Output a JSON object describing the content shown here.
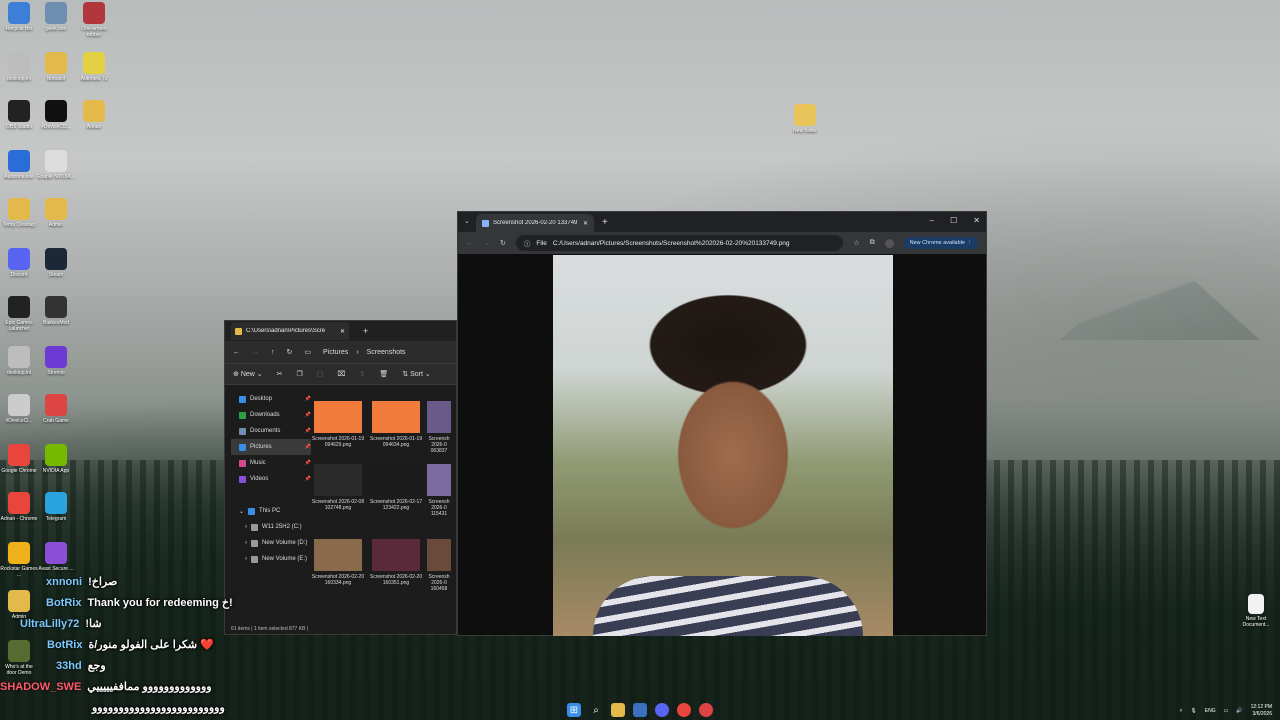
{
  "desktop": {
    "icons_left": [
      {
        "label": "Recycle Bin",
        "icon": "recycle-bin-icon",
        "color": "#3d7fd6"
      },
      {
        "label": "geek.exe",
        "icon": "geek-icon",
        "color": "#6e8fb0"
      },
      {
        "label": "One-armed robber",
        "icon": "oar-icon",
        "color": "#b0383d"
      },
      {
        "label": "desktop.ini",
        "icon": "file-icon",
        "color": "#bdbdbd"
      },
      {
        "label": "Nobusof",
        "icon": "folder-icon",
        "color": "#e3b94b"
      },
      {
        "label": "Autoruns 7z",
        "icon": "archive-icon",
        "color": "#e2d142"
      },
      {
        "label": "OBS Studio",
        "icon": "obs-icon",
        "color": "#222"
      },
      {
        "label": "#DeviceCl3...",
        "icon": "devcln-icon",
        "color": "#111"
      },
      {
        "label": "Adnan",
        "icon": "folder-icon",
        "color": "#e3b94b"
      },
      {
        "label": "Autoruns.exe",
        "icon": "autoruns-icon",
        "color": "#2a6dd6"
      },
      {
        "label": "Enable NVIDIA...",
        "icon": "file-icon",
        "color": "#ddd"
      },
      {
        "label": "Temp Cleanup",
        "icon": "folder-icon",
        "color": "#e3b94b"
      },
      {
        "label": "Admin",
        "icon": "folder-icon",
        "color": "#e3b94b"
      },
      {
        "label": "Discord",
        "icon": "discord-icon",
        "color": "#5865f2"
      },
      {
        "label": "Steam",
        "icon": "steam-icon",
        "color": "#1b2838"
      },
      {
        "label": "Epic Games Launcher",
        "icon": "epic-icon",
        "color": "#222"
      },
      {
        "label": "BakkesMod",
        "icon": "bakkesmod-icon",
        "color": "#333"
      },
      {
        "label": "desktop.ini",
        "icon": "file-icon",
        "color": "#bdbdbd"
      },
      {
        "label": "Stremio",
        "icon": "stremio-icon",
        "color": "#6e3ad6"
      },
      {
        "label": "#DeviceCl...",
        "icon": "file-icon",
        "color": "#ccc"
      },
      {
        "label": "Crab Game",
        "icon": "crab-game-icon",
        "color": "#d44"
      },
      {
        "label": "Google Chrome",
        "icon": "chrome-icon",
        "color": "#e8453c"
      },
      {
        "label": "NVIDIA App",
        "icon": "nvidia-icon",
        "color": "#76b900"
      },
      {
        "label": "Adnan - Chrome",
        "icon": "chrome-icon",
        "color": "#e8453c"
      },
      {
        "label": "Telegram",
        "icon": "telegram-icon",
        "color": "#2aa3df"
      },
      {
        "label": "Rockstar Games ...",
        "icon": "rockstar-icon",
        "color": "#f0b01a"
      },
      {
        "label": "Avast Secure ...",
        "icon": "avast-icon",
        "color": "#8a4fd6"
      },
      {
        "label": "Admin",
        "icon": "folder-icon",
        "color": "#e3b94b"
      },
      {
        "label": "Who's at the door Demo",
        "icon": "game-icon",
        "color": "#556b2f"
      }
    ],
    "new_folder": "New folder",
    "new_text_doc": "New Text Document..."
  },
  "explorer": {
    "tab_title": "C:\\Users\\adnan\\Pictures\\Scre",
    "breadcrumb": [
      "Pictures",
      "Screenshots"
    ],
    "new_label": "New",
    "sort_label": "Sort",
    "sidebar": [
      "Desktop",
      "Downloads",
      "Documents",
      "Pictures",
      "Music",
      "Videos"
    ],
    "this_pc": "This PC",
    "drives": [
      "W11 25H2 (C:)",
      "New Volume (D:)",
      "New Volume (E:)"
    ],
    "thumbs": [
      {
        "label": "Screenshot 2026-01-19 094629.png",
        "color": "#f07b3a"
      },
      {
        "label": "Screenshot 2026-01-19 094634.png",
        "color": "#f07b3a"
      },
      {
        "label": "Screensh 2026-0 063837",
        "color": "#6a5a8a"
      },
      {
        "label": "Screenshot 2026-02-08 102748.png",
        "color": "#2b2b2b"
      },
      {
        "label": "Screenshot 2026-02-17 123422.png",
        "color": "#1b1b1b"
      },
      {
        "label": "Screensh 2026-0 115431",
        "color": "#7a6aa0"
      },
      {
        "label": "Screenshot 2026-02-20 160334.png",
        "color": "#8a6a4a"
      },
      {
        "label": "Screenshot 2026-02-20 160351.png",
        "color": "#5a2a3a"
      },
      {
        "label": "Screensh 2026-0 160458",
        "color": "#6a4a3a"
      }
    ],
    "status": "61 items  |  1 item selected  877 KB  |"
  },
  "chrome": {
    "tab_title": "Screenshot 2026-02-20 133749",
    "url_chip": "File",
    "url": "C:/Users/adnan/Pictures/Screenshots/Screenshot%202026-02-20%20133749.png",
    "update_label": "New Chrome available"
  },
  "chat": [
    {
      "user": "xnnoni",
      "msg": "!صراخ"
    },
    {
      "user": "BotRix",
      "msg": "Thank you for redeeming خ!"
    },
    {
      "user": "UltraLilly72",
      "msg": "!شا"
    },
    {
      "user": "BotRix",
      "msg": "شكرا على الفولو منور/ة ❤️"
    },
    {
      "user": "33hd",
      "msg": "وجع"
    },
    {
      "user": "SHADOW_SWE",
      "msg": "ووووووووووووو مماففيييييي"
    },
    {
      "user": "",
      "msg": "ووووووووووووووووووووووووو"
    }
  ],
  "tray": {
    "lang": "ENG",
    "time": "12:12 PM",
    "date": "3/6/2026"
  }
}
